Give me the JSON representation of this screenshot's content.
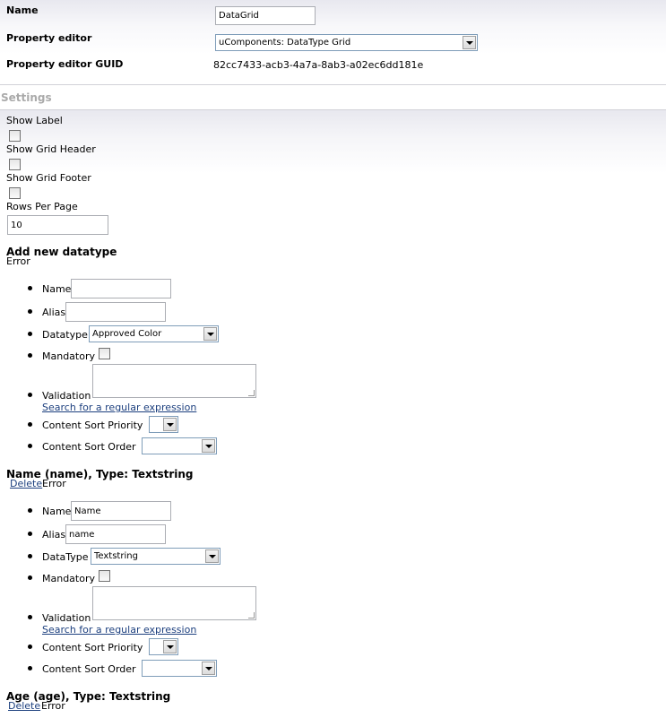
{
  "general": {
    "name_label": "Name",
    "name_value": "DataGrid",
    "editor_label": "Property editor",
    "editor_value": "uComponents: DataType Grid",
    "guid_label": "Property editor GUID",
    "guid_value": "82cc7433-acb3-4a7a-8ab3-a02ec6dd181e"
  },
  "settings": {
    "title": "Settings",
    "show_label": "Show Label",
    "show_grid_header": "Show Grid Header",
    "show_grid_footer": "Show Grid Footer",
    "rows_per_page_label": "Rows Per Page",
    "rows_per_page_value": "10"
  },
  "new_datatype": {
    "heading": "Add new datatype",
    "error": "Error",
    "name_label": "Name",
    "name_value": "",
    "alias_label": "Alias",
    "alias_value": "",
    "datatype_label": "Datatype",
    "datatype_value": "Approved Color",
    "mandatory_label": "Mandatory",
    "validation_label": "Validation",
    "regex_link": "Search for a regular expression",
    "sort_priority_label": "Content Sort Priority",
    "sort_priority_value": "",
    "sort_order_label": "Content Sort Order",
    "sort_order_value": ""
  },
  "columns": [
    {
      "heading": "Name (name), Type: Textstring",
      "delete": "Delete",
      "error": "Error",
      "name_label": "Name",
      "name_value": "Name",
      "alias_label": "Alias",
      "alias_value": "name",
      "datatype_label": "DataType",
      "datatype_value": "Textstring",
      "mandatory_label": "Mandatory",
      "validation_label": "Validation",
      "regex_link": "Search for a regular expression",
      "sort_priority_label": "Content Sort Priority",
      "sort_priority_value": "",
      "sort_order_label": "Content Sort Order",
      "sort_order_value": ""
    },
    {
      "heading": "Age (age), Type: Textstring",
      "delete": "Delete",
      "error": "Error"
    }
  ]
}
